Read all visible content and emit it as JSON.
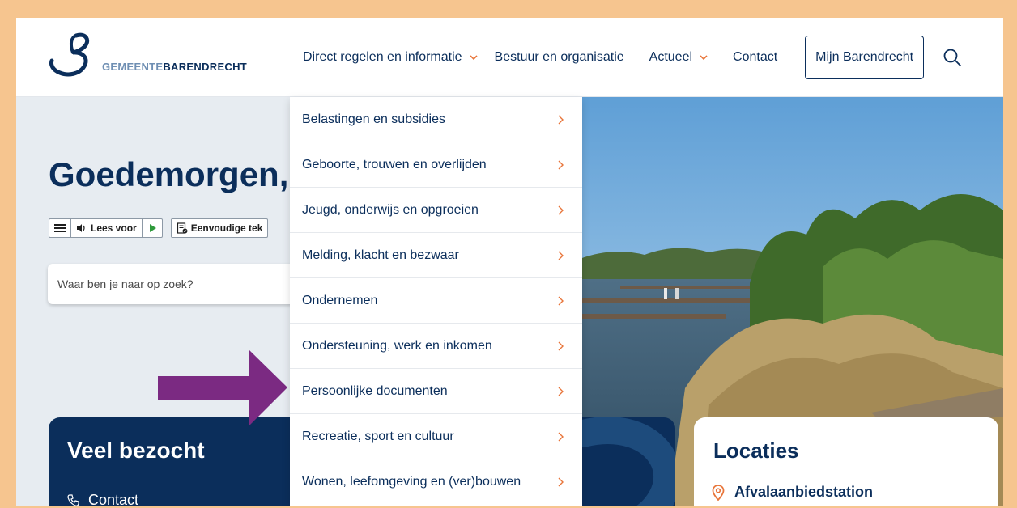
{
  "logo": {
    "text_light": "GEMEENTE",
    "text_strong": "BARENDRECHT"
  },
  "nav": {
    "direct": "Direct regelen en informatie",
    "bestuur": "Bestuur en organisatie",
    "actueel": "Actueel",
    "contact": "Contact",
    "mijn": "Mijn Barendrecht"
  },
  "hero": {
    "greeting": "Goedemorgen,",
    "readspeaker_listen": "Lees voor",
    "readspeaker_simple": "Eenvoudige tek",
    "search_placeholder": "Waar ben je naar op zoek?"
  },
  "dropdown": {
    "items": [
      {
        "label": "Belastingen en subsidies"
      },
      {
        "label": "Geboorte, trouwen en overlijden"
      },
      {
        "label": "Jeugd, onderwijs en opgroeien"
      },
      {
        "label": "Melding, klacht en bezwaar"
      },
      {
        "label": "Ondernemen"
      },
      {
        "label": "Ondersteuning, werk en inkomen"
      },
      {
        "label": "Persoonlijke documenten"
      },
      {
        "label": "Recreatie, sport en cultuur"
      },
      {
        "label": "Wonen, leefomgeving en (ver)bouwen"
      }
    ]
  },
  "veel_bezocht": {
    "title": "Veel bezocht",
    "first_item": "Contact"
  },
  "locaties": {
    "title": "Locaties",
    "first_item": "Afvalaanbiedstation"
  },
  "colors": {
    "brand_navy": "#0b2e5b",
    "accent_orange": "#e8753a",
    "arrow_purple": "#7b2a82",
    "frame_border": "#f6c58f"
  }
}
